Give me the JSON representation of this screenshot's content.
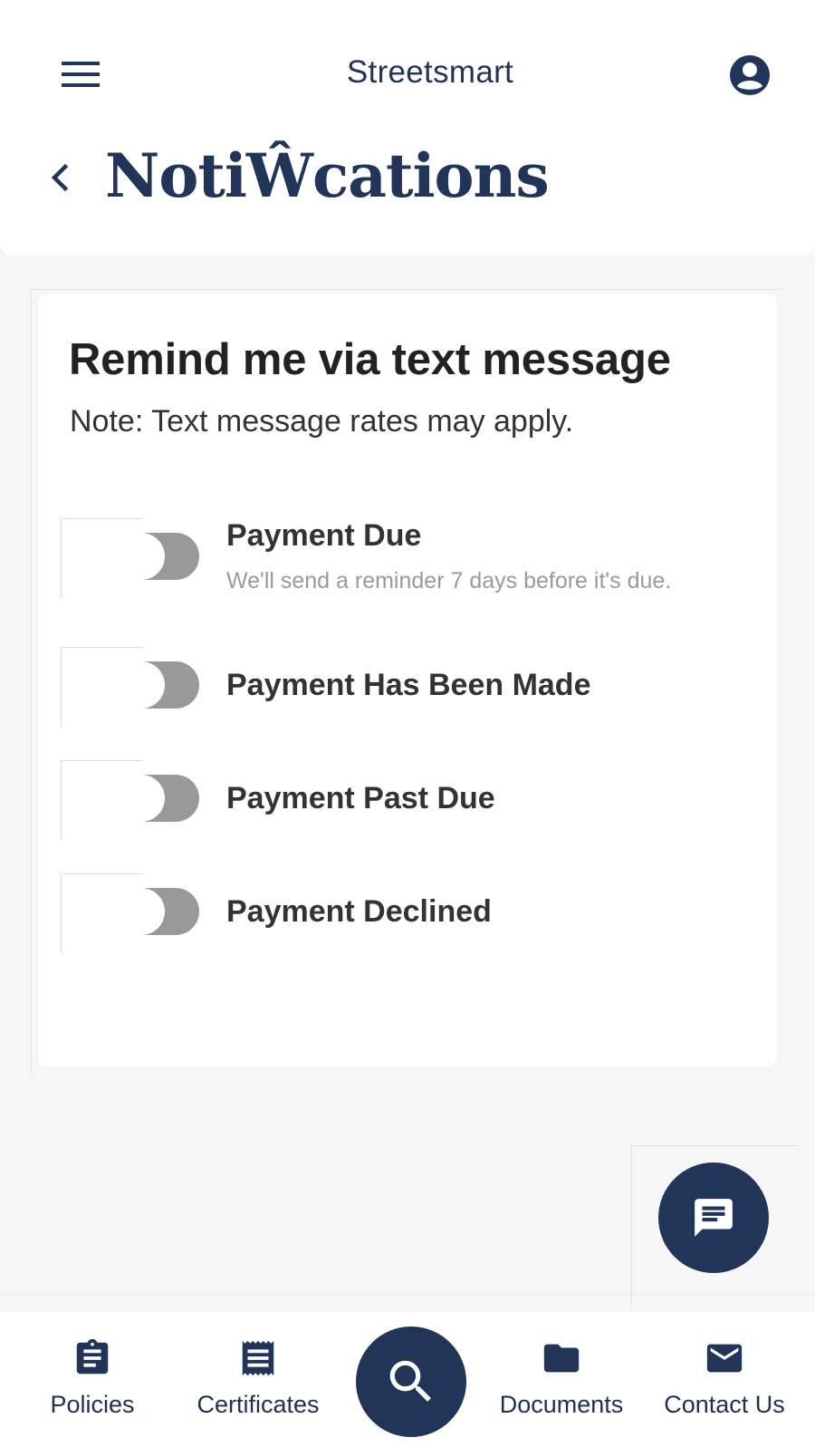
{
  "header": {
    "app_title": "Streetsmart",
    "page_title": "NotiŴcations",
    "icons": {
      "menu": "menu-icon",
      "account": "account-circle-icon",
      "back": "chevron-left-icon"
    }
  },
  "card": {
    "title": "Remind me via text message",
    "note": "Note: Text message rates may apply.",
    "toggles": [
      {
        "label": "Payment Due",
        "sublabel": "We'll send a reminder 7 days before it's due.",
        "enabled": false
      },
      {
        "label": "Payment Has Been Made",
        "enabled": false
      },
      {
        "label": "Payment Past Due",
        "enabled": false
      },
      {
        "label": "Payment Declined",
        "enabled": false
      }
    ]
  },
  "chat_button": {
    "icon": "chat-icon"
  },
  "bottom_nav": {
    "items": [
      {
        "label": "Policies",
        "icon": "clipboard-icon"
      },
      {
        "label": "Certificates",
        "icon": "receipt-icon"
      },
      {
        "label": "",
        "icon": "search-icon"
      },
      {
        "label": "Documents",
        "icon": "folder-icon"
      },
      {
        "label": "Contact Us",
        "icon": "mail-icon"
      }
    ]
  },
  "colors": {
    "brand": "#213558",
    "background": "#f6f6f6",
    "toggle_track": "#999999",
    "text_muted": "#9a9a9a"
  }
}
